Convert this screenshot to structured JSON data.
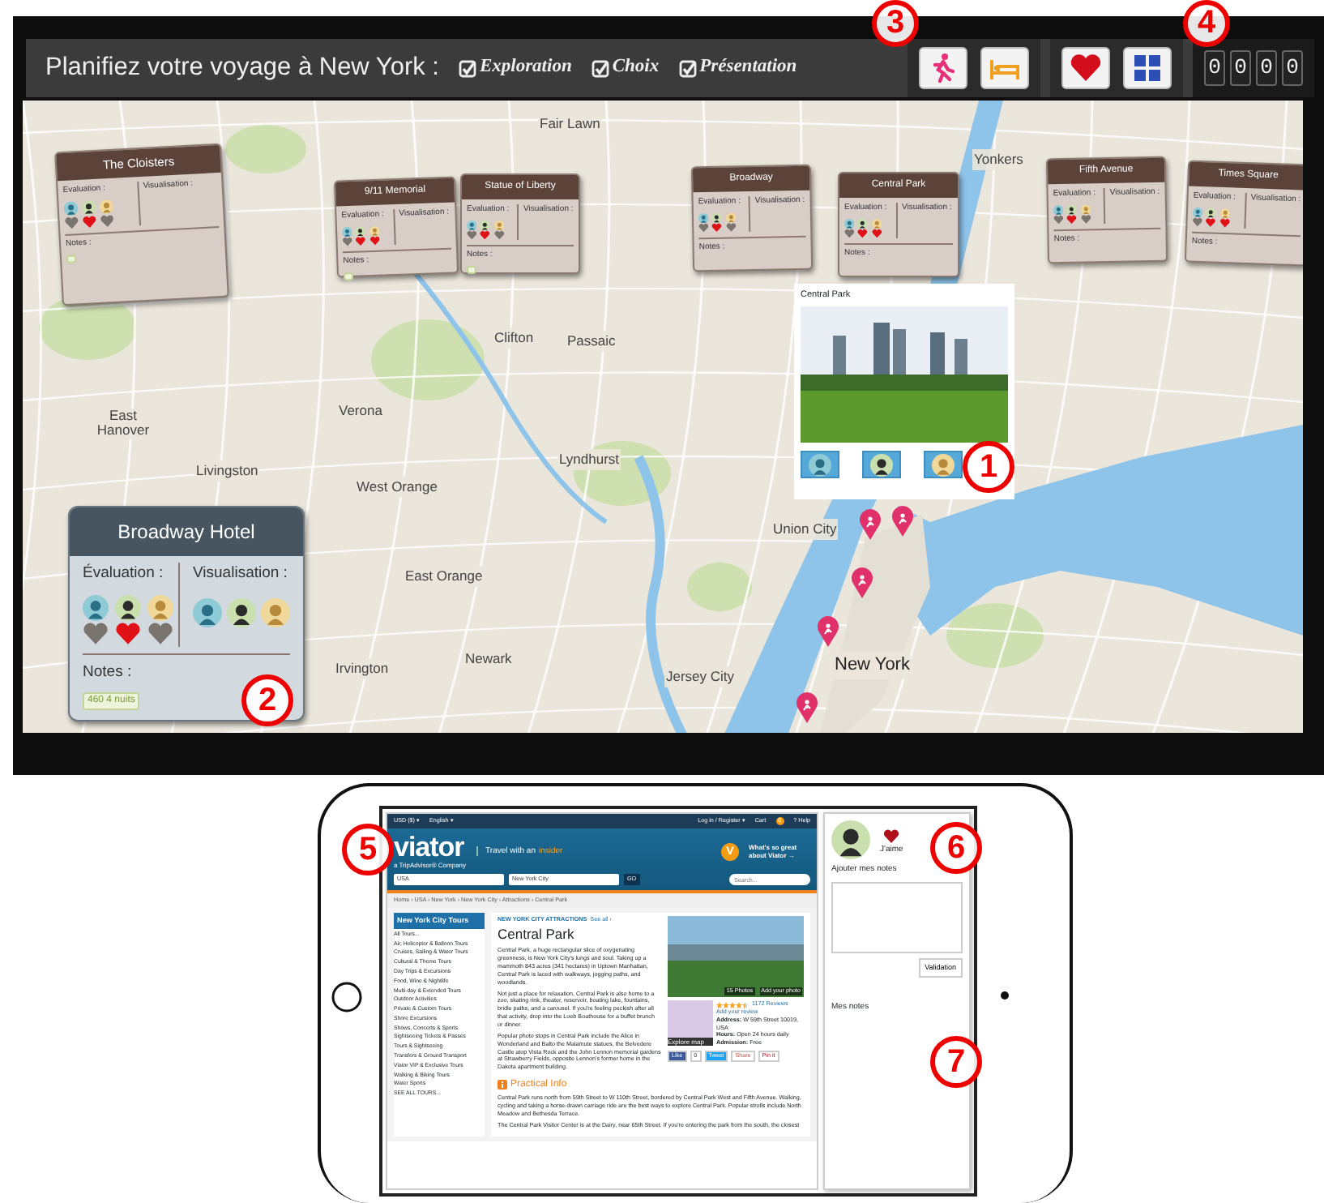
{
  "app": {
    "title": "Planifiez votre voyage à New York :",
    "modes": [
      {
        "label": "Exploration",
        "checked": true
      },
      {
        "label": "Choix",
        "checked": true
      },
      {
        "label": "Présentation",
        "checked": true
      }
    ],
    "toolbar": [
      {
        "kind": "activity",
        "selected": true
      },
      {
        "kind": "hotel",
        "selected": true
      },
      {
        "kind": "favorite",
        "selected": true
      },
      {
        "kind": "grid",
        "selected": true
      }
    ],
    "counter": [
      "0",
      "0",
      "0",
      "0"
    ]
  },
  "map": {
    "places": [
      "Fair Lawn",
      "Yonkers",
      "Clifton",
      "Passaic",
      "Verona",
      "East Hanover",
      "Lyndhurst",
      "West Orange",
      "Livingston",
      "Union City",
      "East Orange",
      "Irvington",
      "Newark",
      "Jersey City",
      "New York"
    ],
    "cards": [
      {
        "kind": "attraction",
        "name": "The Cloisters",
        "eval_label": "Evaluation :",
        "vis_label": "Visualisation :",
        "notes_label": "Notes :",
        "evaluation": [
          false,
          true,
          false
        ],
        "viewed": false,
        "note_chip": true
      },
      {
        "kind": "attraction",
        "name": "9/11 Memorial",
        "eval_label": "Evaluation :",
        "vis_label": "Visualisation :",
        "notes_label": "Notes :",
        "evaluation": [
          false,
          true,
          true
        ],
        "viewed": false,
        "note_chip": true
      },
      {
        "kind": "attraction",
        "name": "Statue of Liberty",
        "eval_label": "Evaluation :",
        "vis_label": "Visualisation :",
        "notes_label": "Notes :",
        "evaluation": [
          false,
          true,
          false
        ],
        "viewed": false,
        "note_chip": true
      },
      {
        "kind": "attraction",
        "name": "Broadway",
        "eval_label": "Evaluation :",
        "vis_label": "Visualisation :",
        "notes_label": "Notes :",
        "evaluation": [
          false,
          true,
          false
        ],
        "viewed": false,
        "note_chip": false
      },
      {
        "kind": "attraction",
        "name": "Central Park",
        "eval_label": "Evaluation :",
        "vis_label": "Visualisation :",
        "notes_label": "Notes :",
        "evaluation": [
          false,
          true,
          true
        ],
        "viewed": false,
        "note_chip": false
      },
      {
        "kind": "attraction",
        "name": "Fifth Avenue",
        "eval_label": "Evaluation :",
        "vis_label": "Visualisation :",
        "notes_label": "Notes :",
        "evaluation": [
          false,
          true,
          false
        ],
        "viewed": false,
        "note_chip": false
      },
      {
        "kind": "attraction",
        "name": "Times Square",
        "eval_label": "Evaluation :",
        "vis_label": "Visualisation :",
        "notes_label": "Notes :",
        "evaluation": [
          false,
          true,
          true
        ],
        "viewed": false,
        "note_chip": false
      },
      {
        "kind": "hotel",
        "name": "Broadway Hotel",
        "eval_label": "Évaluation :",
        "vis_label": "Visualisation :",
        "notes_label": "Notes :",
        "evaluation": [
          false,
          true,
          false
        ],
        "viewed": true,
        "note_chip": true,
        "note": "460 4 nuits"
      }
    ],
    "popup": {
      "title": "Central Park"
    }
  },
  "callouts": [
    "1",
    "2",
    "3",
    "4",
    "5",
    "6",
    "7"
  ],
  "tablet": {
    "site": {
      "currency": "USD ($) ▾",
      "language": "English ▾",
      "login": "Log in / Register ▾",
      "cart": "Cart",
      "cart_count": "0",
      "help": "? Help",
      "logo": "viator",
      "logo_sub": "a TripAdvisor® Company",
      "tagline": "Travel with an",
      "tagline_accent": "insider",
      "promo": "What's so great about Viator →",
      "promo_icon": "V",
      "country": "USA",
      "city": "New York City",
      "go": "GO",
      "search_placeholder": "Search...",
      "breadcrumb": "Home › USA › New York › New York City › Attractions › Central Park",
      "sidebar_title": "New York City Tours",
      "sidebar_items": [
        "All Tours...",
        "Air, Helicopter & Balloon Tours",
        "Cruises, Sailing & Water Tours",
        "Cultural & Theme Tours",
        "Day Trips & Excursions",
        "Food, Wine & Nightlife",
        "Multi-day & Extended Tours",
        "Outdoor Activities",
        "Private & Custom Tours",
        "Shore Excursions",
        "Shows, Concerts & Sports",
        "Sightseeing Tickets & Passes",
        "Tours & Sightseeing",
        "Transfers & Ground Transport",
        "Viator VIP & Exclusive Tours",
        "Walking & Biking Tours",
        "Water Sports",
        "SEE ALL TOURS..."
      ],
      "kicker": "NEW YORK CITY ATTRACTIONS",
      "see_all": "See all ›",
      "heading": "Central Park",
      "paragraphs": [
        "Central Park, a huge rectangular slice of oxygenating greenness, is New York City's lungs and soul. Taking up a mammoth 843 acres (341 hectares) in Uptown Manhattan, Central Park is laced with walkways, jogging paths, and woodlands.",
        "Not just a place for relaxation, Central Park is also home to a zoo, skating rink, theater, reservoir, boating lake, fountains, bridle paths, and a carousel. If you're feeling peckish after all that activity, drop into the Loeb Boathouse for a buffet brunch or dinner.",
        "Popular photo stops in Central Park include the Alice in Wonderland and Balto the Malamute statues, the Belvedere Castle atop Vista Rock and the John Lennon memorial gardens at Strawberry Fields, opposite Lennon's former home in the Dakota apartment building."
      ],
      "photos": "15 Photos",
      "add_photo": "Add your photo",
      "stars": 4.5,
      "reviews": "1172 Reviews",
      "add_review": "Add your review",
      "explore_map": "Explore map",
      "facts": [
        "**Address:** W 59th Street 10019, USA",
        "**Hours:** Open 24 hours daily",
        "**Admission:** Free"
      ],
      "social": [
        "Like",
        "0",
        "Tweet",
        "Share",
        "Pin it"
      ],
      "practical_title": "Practical Info",
      "practical": [
        "Central Park runs north from 59th Street to W 110th Street, bordered by Central Park West and Fifth Avenue. Walking, cycling and taking a horse-drawn carriage ride are the best ways to explore Central Park. Popular strolls include North Meadow and Bethesda Terrace.",
        "The Central Park Visitor Center is at the Dairy, near 65th Street. If you're entering the park from the south, the closest"
      ]
    },
    "panel": {
      "liked": true,
      "like_label": "J'aime",
      "notes_label": "Ajouter mes notes",
      "submit": "Validation",
      "my_notes": "Mes notes"
    }
  }
}
